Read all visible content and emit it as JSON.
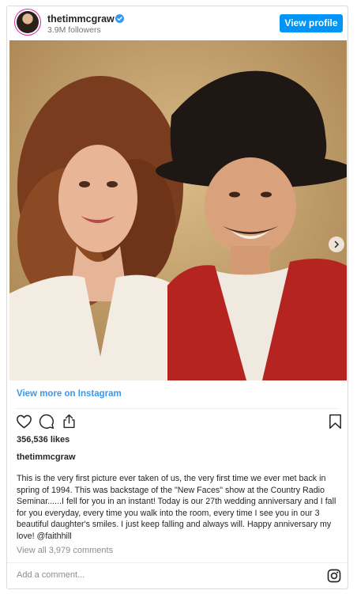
{
  "header": {
    "username": "thetimmcgraw",
    "followers": "3.9M followers",
    "view_profile_label": "View profile"
  },
  "media": {
    "description_icon": "photo",
    "carousel_count": 2,
    "carousel_active_index": 0
  },
  "view_more_label": "View more on Instagram",
  "actions": {
    "icons": [
      "heart-icon",
      "comment-icon",
      "share-icon",
      "bookmark-icon"
    ]
  },
  "likes": "356,536 likes",
  "caption": {
    "username": "thetimmcgraw",
    "text": "This is the very first picture ever taken of us, the very first time we ever met back in spring of 1994.  This was backstage of the \"New Faces\" show at the Country Radio Seminar......I fell for you in an instant!  Today is our 27th wedding anniversary and I fall for you everyday, every time you walk into the room, every time I see you in our 3 beautiful daughter's smiles. I just keep falling and always will.  Happy anniversary my love! @faithhill"
  },
  "view_all_comments": "View all 3,979 comments",
  "add_comment_placeholder": "Add a comment...",
  "colors": {
    "accent": "#0095f6",
    "link": "#3897f0",
    "muted": "#8e8e8e"
  }
}
